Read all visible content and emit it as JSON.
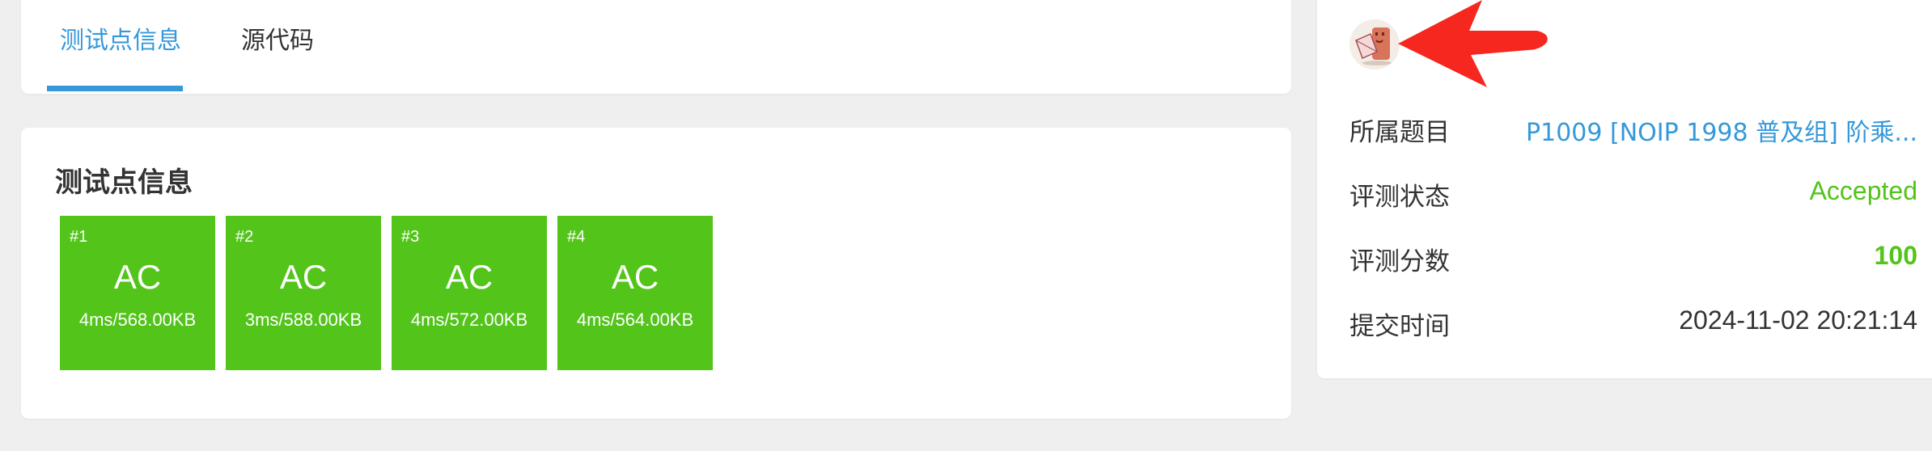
{
  "tabs": [
    {
      "label": "测试点信息",
      "active": true
    },
    {
      "label": "源代码",
      "active": false
    }
  ],
  "testcases": {
    "title": "测试点信息",
    "items": [
      {
        "num": "#1",
        "result": "AC",
        "stat": "4ms/568.00KB"
      },
      {
        "num": "#2",
        "result": "AC",
        "stat": "3ms/588.00KB"
      },
      {
        "num": "#3",
        "result": "AC",
        "stat": "4ms/572.00KB"
      },
      {
        "num": "#4",
        "result": "AC",
        "stat": "4ms/564.00KB"
      }
    ]
  },
  "info": {
    "problem_label": "所属题目",
    "problem_value": "P1009 [NOIP 1998 普及组] 阶乘...",
    "status_label": "评测状态",
    "status_value": "Accepted",
    "score_label": "评测分数",
    "score_value": "100",
    "time_label": "提交时间",
    "time_value": "2024-11-02 20:21:14"
  },
  "colors": {
    "accent": "#3498db",
    "accepted": "#52c41a",
    "arrow": "#f5271f"
  },
  "icons": {
    "avatar": "user-avatar",
    "arrow": "red-arrow-annotation"
  }
}
